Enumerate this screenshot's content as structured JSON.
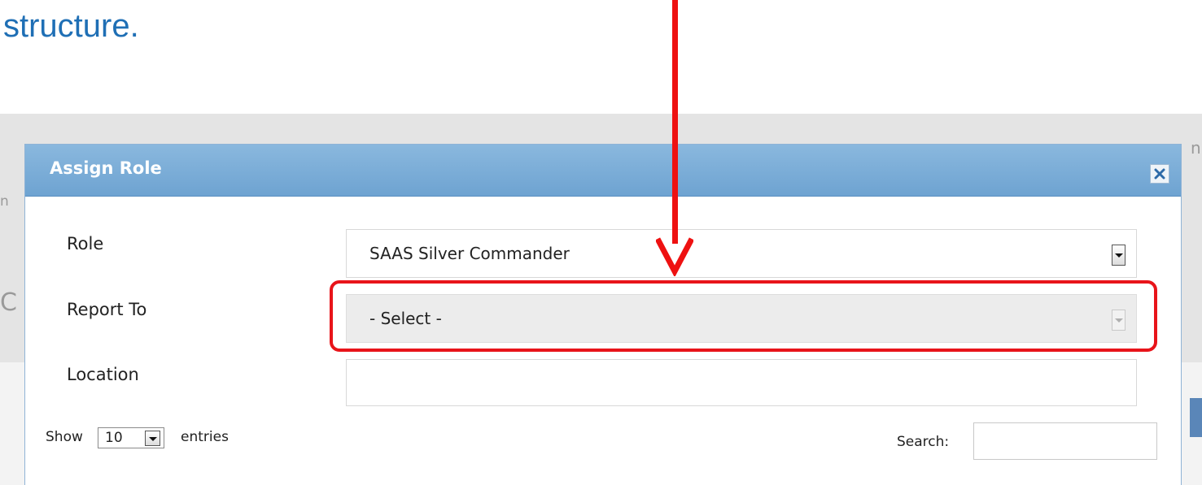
{
  "slide": {
    "caption": "structure."
  },
  "background": {
    "frag_top_right": "n",
    "frag_left_1": "n",
    "frag_left_2": "C"
  },
  "modal": {
    "title": "Assign Role",
    "close_icon": "close-icon",
    "fields": {
      "role": {
        "label": "Role",
        "value": "SAAS Silver Commander"
      },
      "report_to": {
        "label": "Report To",
        "value": "- Select -",
        "disabled": true
      },
      "location": {
        "label": "Location",
        "value": ""
      }
    },
    "table_controls": {
      "show_label": "Show",
      "page_length": "10",
      "entries_label": "entries",
      "search_label": "Search:",
      "search_value": ""
    }
  },
  "colors": {
    "header_blue": "#7aaed8",
    "caption_blue": "#1f6fb5",
    "annotation_red": "#e8141a"
  }
}
